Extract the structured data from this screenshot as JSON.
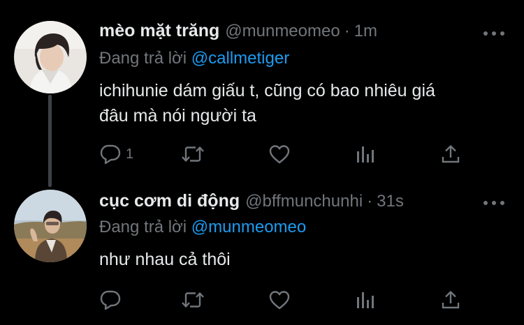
{
  "tweets": [
    {
      "display_name": "mèo mặt trăng",
      "handle": "@munmeomeo",
      "separator": "·",
      "time": "1m",
      "replying_prefix": "Đang trả lời",
      "replying_to": "@callmetiger",
      "text_line1": "ichihunie dám giấu t, cũng có bao nhiêu giá",
      "text_line2": "đâu mà nói người ta",
      "reply_count": "1",
      "retweet_count": "",
      "like_count": "",
      "avatar_icon": "person-photo-avatar"
    },
    {
      "display_name": "cục cơm di động",
      "handle": "@bffmunchunhi",
      "separator": "·",
      "time": "31s",
      "replying_prefix": "Đang trả lời",
      "replying_to": "@munmeomeo",
      "text_line1": "như nhau cả thôi",
      "reply_count": "",
      "retweet_count": "",
      "like_count": "",
      "avatar_icon": "person-photo-avatar"
    }
  ],
  "icons": {
    "reply": "reply-icon",
    "retweet": "retweet-icon",
    "like": "heart-icon",
    "stats": "stats-icon",
    "share": "share-icon",
    "more": "more-icon"
  },
  "colors": {
    "background": "#000000",
    "text": "#e7e9ea",
    "muted": "#71767b",
    "link": "#1d9bf0",
    "thread_line": "#3d4147"
  }
}
